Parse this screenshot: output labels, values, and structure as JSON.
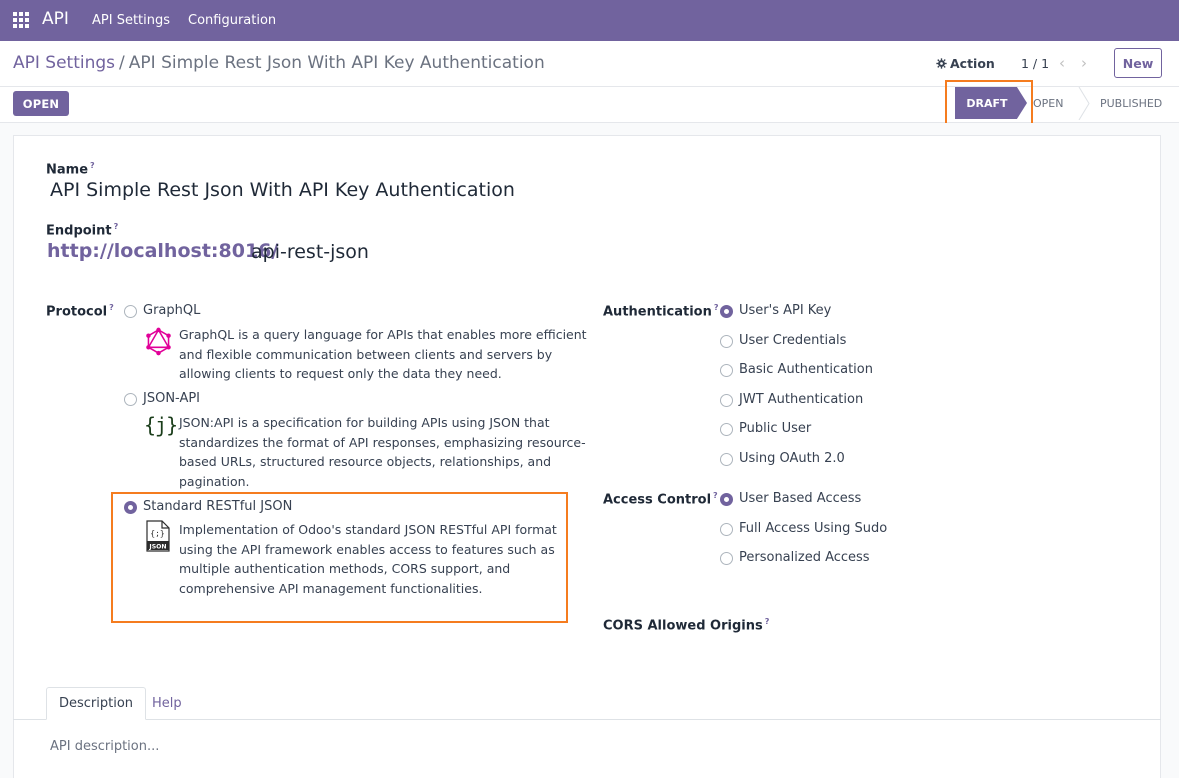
{
  "navbar": {
    "brand": "API",
    "menu": [
      "API Settings",
      "Configuration"
    ]
  },
  "breadcrumb": {
    "parent": "API Settings",
    "separator": "/",
    "current": "API Simple Rest Json With API Key Authentication"
  },
  "control": {
    "action_label": "Action",
    "pager": "1 / 1",
    "new_label": "New"
  },
  "statusbar": {
    "open_button": "OPEN",
    "stages": [
      "DRAFT",
      "OPEN",
      "PUBLISHED"
    ],
    "active_stage": "DRAFT"
  },
  "form": {
    "name_label": "Name",
    "name_value": "API Simple Rest Json With API Key Authentication",
    "endpoint_label": "Endpoint",
    "endpoint_base": "http://localhost:8016/",
    "endpoint_path": "api-rest-json",
    "tooltip_mark": "?",
    "protocol": {
      "label": "Protocol",
      "options": [
        {
          "label": "GraphQL",
          "checked": false,
          "icon": "graphql-icon",
          "description": [
            "GraphQL is a query language for APIs that enables more efficient",
            "and flexible communication between clients and servers by",
            "allowing clients to request only the data they need."
          ]
        },
        {
          "label": "JSON-API",
          "checked": false,
          "icon": "json-api-icon",
          "description": [
            "JSON:API is a specification for building APIs using JSON that",
            "standardizes the format of API responses, emphasizing resource-",
            "based URLs, structured resource objects, relationships, and",
            "pagination."
          ]
        },
        {
          "label": "Standard RESTful JSON",
          "checked": true,
          "icon": "json-file-icon",
          "description": [
            "Implementation of Odoo's standard JSON RESTful API format",
            "using the API framework enables access to features such as",
            "multiple authentication methods, CORS support, and",
            "comprehensive API management functionalities."
          ]
        }
      ]
    },
    "authentication": {
      "label": "Authentication",
      "options": [
        "User's API Key",
        "User Credentials",
        "Basic Authentication",
        "JWT Authentication",
        "Public User",
        "Using OAuth 2.0"
      ],
      "selected": 0
    },
    "access_control": {
      "label": "Access Control",
      "options": [
        "User Based Access",
        "Full Access Using Sudo",
        "Personalized Access"
      ],
      "selected": 0
    },
    "cors_label": "CORS Allowed Origins"
  },
  "notebook": {
    "tabs": [
      "Description",
      "Help"
    ],
    "placeholder": "API description..."
  },
  "colors": {
    "primary": "#71639e",
    "highlight": "#f57c1f"
  }
}
